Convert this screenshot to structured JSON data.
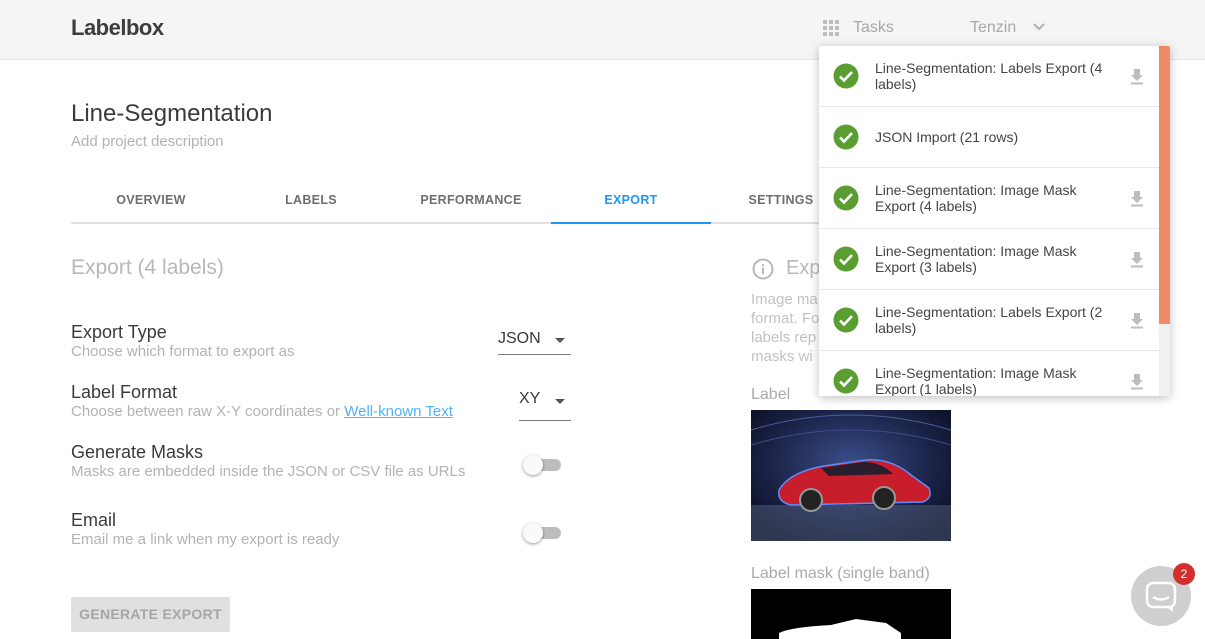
{
  "header": {
    "logo": "Labelbox",
    "tasks_label": "Tasks",
    "user_name": "Tenzin"
  },
  "project": {
    "title": "Line-Segmentation",
    "description": "Add project description"
  },
  "tabs": [
    {
      "label": "OVERVIEW",
      "active": false
    },
    {
      "label": "LABELS",
      "active": false
    },
    {
      "label": "PERFORMANCE",
      "active": false
    },
    {
      "label": "EXPORT",
      "active": true
    },
    {
      "label": "SETTINGS",
      "active": false
    }
  ],
  "export": {
    "section_title": "Export (4 labels)",
    "export_type": {
      "title": "Export Type",
      "desc": "Choose which format to export as",
      "value": "JSON"
    },
    "label_format": {
      "title": "Label Format",
      "desc": "Choose between raw X-Y coordinates or ",
      "link": "Well-known Text",
      "value": "XY"
    },
    "generate_masks": {
      "title": "Generate Masks",
      "desc": "Masks are embedded inside the JSON or CSV file as URLs",
      "enabled": false
    },
    "email": {
      "title": "Email",
      "desc": "Email me a link when my export is ready",
      "enabled": false
    },
    "generate_button": "GENERATE EXPORT"
  },
  "example": {
    "title": "Exp",
    "para_lines": [
      "Image ma",
      "format. Fo",
      "labels rep",
      "masks wi"
    ],
    "label_caption": "Label",
    "mask_caption": "Label mask (single band)"
  },
  "tasks_popup": {
    "items": [
      {
        "text": "Line-Segmentation: Labels Export (4 labels)",
        "downloadable": true
      },
      {
        "text": "JSON Import (21 rows)",
        "downloadable": false
      },
      {
        "text": "Line-Segmentation: Image Mask Export (4 labels)",
        "downloadable": true
      },
      {
        "text": "Line-Segmentation: Image Mask Export (3 labels)",
        "downloadable": true
      },
      {
        "text": "Line-Segmentation: Labels Export (2 labels)",
        "downloadable": true
      },
      {
        "text": "Line-Segmentation: Image Mask Export (1 labels)",
        "downloadable": true
      }
    ]
  },
  "chat": {
    "badge_count": "2"
  },
  "colors": {
    "accent": "#2196f3",
    "success": "#5a9e32",
    "scroll_thumb": "#f08a65",
    "badge": "#d32f2f"
  }
}
